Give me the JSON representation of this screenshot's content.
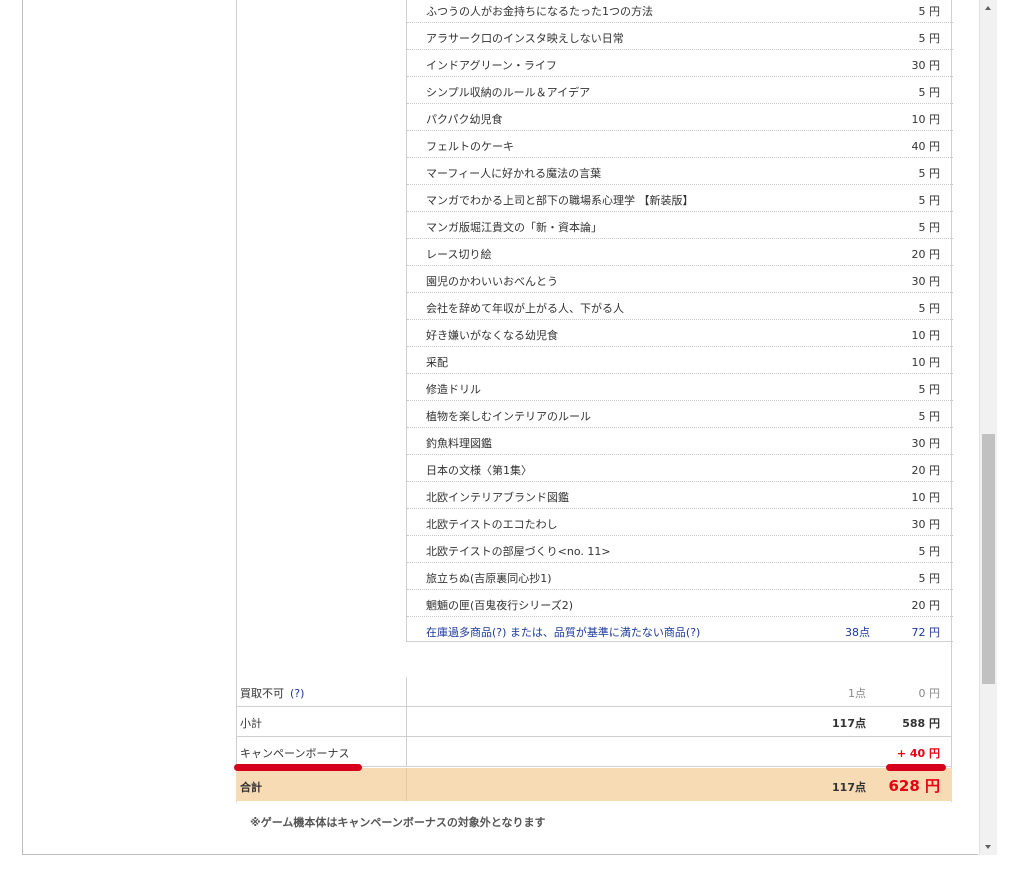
{
  "items": [
    {
      "title": "ふつうの人がお金持ちになるたった1つの方法",
      "price": "5 円"
    },
    {
      "title": "アラサーク口のインスタ映えしない日常",
      "price": "5 円"
    },
    {
      "title": "インドアグリーン・ライフ",
      "price": "30 円"
    },
    {
      "title": "シンプル収納のルール＆アイデア",
      "price": "5 円"
    },
    {
      "title": "パクパク幼児食",
      "price": "10 円"
    },
    {
      "title": "フェルトのケーキ",
      "price": "40 円"
    },
    {
      "title": "マーフィー人に好かれる魔法の言葉",
      "price": "5 円"
    },
    {
      "title": "マンガでわかる上司と部下の職場系心理学 【新装版】",
      "price": "5 円"
    },
    {
      "title": "マンガ版堀江貴文の「新・資本論」",
      "price": "5 円"
    },
    {
      "title": "レース切り絵",
      "price": "20 円"
    },
    {
      "title": "園児のかわいいおべんとう",
      "price": "30 円"
    },
    {
      "title": "会社を辞めて年収が上がる人、下がる人",
      "price": "5 円"
    },
    {
      "title": "好き嫌いがなくなる幼児食",
      "price": "10 円"
    },
    {
      "title": "采配",
      "price": "10 円"
    },
    {
      "title": "修造ドリル",
      "price": "5 円"
    },
    {
      "title": "植物を楽しむインテリアのルール",
      "price": "5 円"
    },
    {
      "title": "釣魚料理図鑑",
      "price": "30 円"
    },
    {
      "title": "日本の文様〈第1集〉",
      "price": "20 円"
    },
    {
      "title": "北欧インテリアブランド図鑑",
      "price": "10 円"
    },
    {
      "title": "北欧テイストのエコたわし",
      "price": "30 円"
    },
    {
      "title": "北欧テイストの部屋づくり<no. 11>",
      "price": "5 円"
    },
    {
      "title": "旅立ちぬ(吉原裏同心抄1)",
      "price": "5 円"
    },
    {
      "title": "魍魎の匣(百鬼夜行シリーズ2)",
      "price": "20 円"
    }
  ],
  "excess_row": {
    "title": "在庫過多商品(?) または、品質が基準に満たない商品(?)",
    "count": "38点",
    "price": "72 円"
  },
  "rejected": {
    "label": "買取不可",
    "help": "(?)",
    "count": "1点",
    "price": "0 円"
  },
  "subtotal": {
    "label": "小計",
    "count": "117点",
    "price": "588 円"
  },
  "campaign": {
    "label": "キャンペーンボーナス",
    "price": "+ 40 円"
  },
  "total": {
    "label": "合計",
    "count": "117点",
    "price": "628 円"
  },
  "note": "※ゲーム機本体はキャンペーンボーナスの対象外となります",
  "colors": {
    "accent_red": "#e60012",
    "link_blue": "#1a3a9a",
    "total_bg": "#f6dbb5",
    "highlight_mark": "#d6001c"
  },
  "icons": {
    "scroll_up": "triangle-up",
    "scroll_down": "triangle-down"
  }
}
